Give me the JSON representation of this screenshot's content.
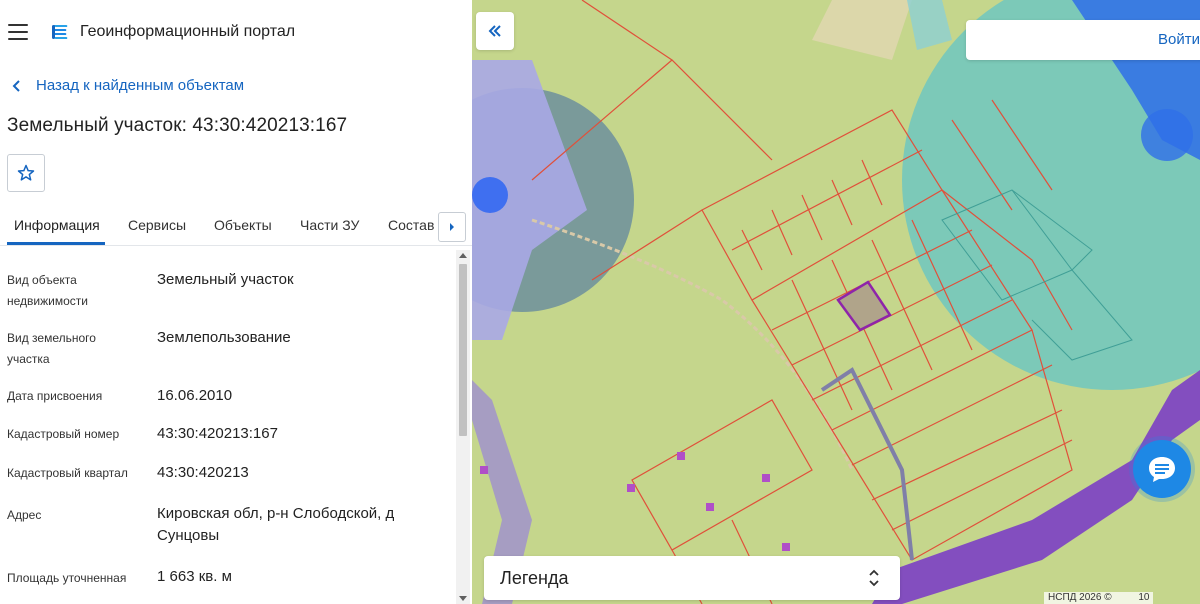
{
  "header": {
    "portal_title": "Геоинформационный портал"
  },
  "navigation": {
    "back_label": "Назад к найденным объектам"
  },
  "object": {
    "title": "Земельный участок: 43:30:420213:167"
  },
  "tabs": [
    {
      "label": "Информация",
      "active": true
    },
    {
      "label": "Сервисы",
      "active": false
    },
    {
      "label": "Объекты",
      "active": false
    },
    {
      "label": "Части ЗУ",
      "active": false
    },
    {
      "label": "Состав",
      "active": false
    }
  ],
  "properties": [
    {
      "label": "Вид объекта недвижимости",
      "value": "Земельный участок"
    },
    {
      "label": "Вид земельного участка",
      "value": "Землепользование"
    },
    {
      "label": "Дата присвоения",
      "value": "16.06.2010"
    },
    {
      "label": "Кадастровый номер",
      "value": "43:30:420213:167"
    },
    {
      "label": "Кадастровый квартал",
      "value": "43:30:420213"
    },
    {
      "label": "Адрес",
      "value": "Кировская обл, р-н Слободской, д Сунцовы"
    },
    {
      "label": "Площадь уточненная",
      "value": "1 663 кв. м"
    }
  ],
  "map": {
    "login_label": "Войти",
    "legend_label": "Легенда",
    "attribution": "НСПД 2026 ©",
    "attribution_extra": "10"
  },
  "colors": {
    "accent": "#1565c0",
    "parcel_border": "#e0503a",
    "selected_parcel": "#8e24aa",
    "zone_teal": "#5fc7c0",
    "zone_green": "#c5d68c",
    "road_purple": "#7b3fc4"
  },
  "icons": {
    "menu": "hamburger-icon",
    "logo": "portal-logo",
    "back": "chevron-left-icon",
    "favorite": "star-outline-icon",
    "tab_scroll": "chevron-right-icon",
    "collapse": "double-chevron-left-icon",
    "chat": "chat-bubble-icon",
    "legend_toggle": "unfold-icon"
  }
}
